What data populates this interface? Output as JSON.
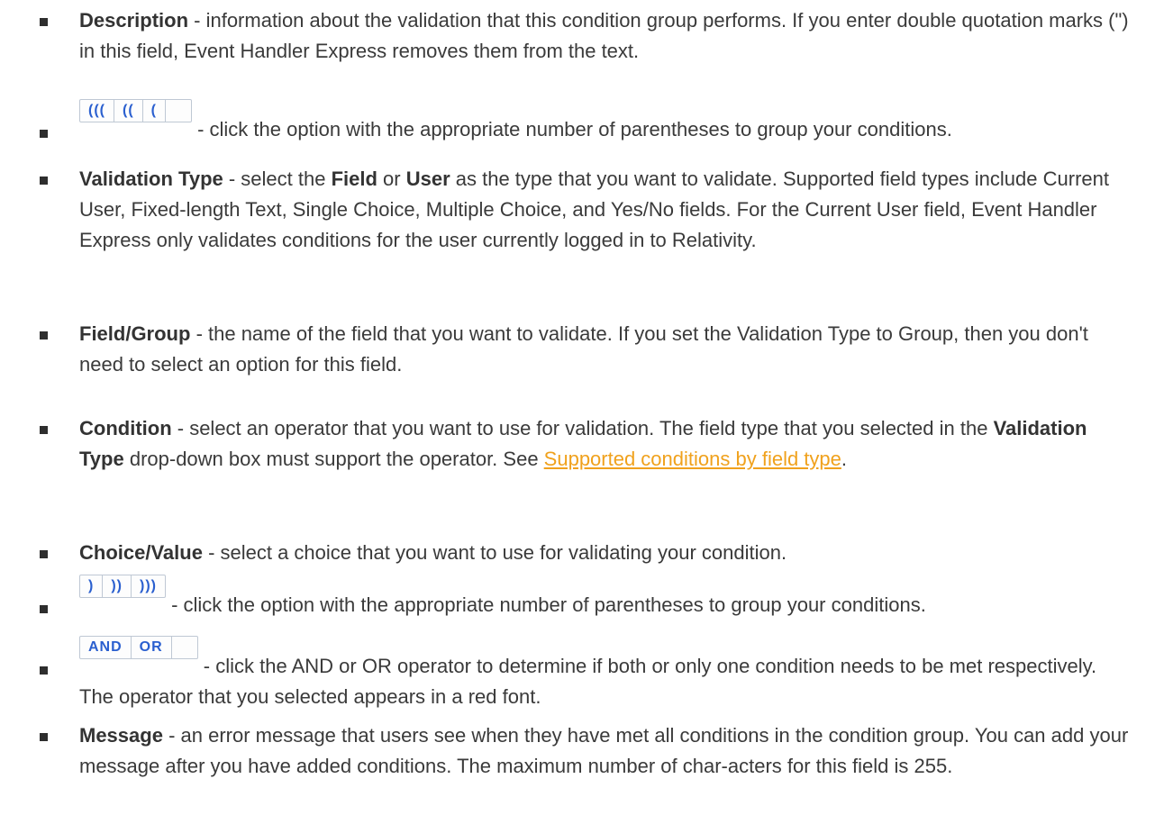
{
  "items": [
    {
      "term": "Description",
      "text": " - information about the validation that this condition group performs. If you enter double quotation marks (\") in this field, Event Handler Express removes them from the text."
    },
    {
      "buttons": [
        "(((",
        "((",
        "("
      ],
      "text": "- click the option with the appropriate number of parentheses to group your conditions."
    },
    {
      "term": "Validation Type",
      "text_a": " - select the ",
      "term_b": "Field",
      "text_b": " or ",
      "term_c": "User",
      "text_c": " as the type that you want to validate. Supported field types include Current User, Fixed-length Text, Single Choice, Multiple Choice, and Yes/No fields. For the Current User field, Event Handler Express only validates conditions for the user currently logged in to Relativity."
    },
    {
      "term": "Field/Group",
      "text": " - the name of the field that you want to validate. If you set the Validation Type to Group, then you don't need to select an option for this field."
    },
    {
      "term": "Condition",
      "text_a": " - select an operator that you want to use for validation. The field type that you selected in the ",
      "term_b": "Validation Type",
      "text_b": " drop-down box must support the operator. See ",
      "link": "Supported conditions by field type",
      "text_c": "."
    },
    {
      "term": "Choice/Value",
      "text": " - select a choice that you want to use for validating your condition."
    },
    {
      "buttons": [
        ")",
        "))",
        ")))"
      ],
      "text": "- click the option with the appropriate number of parentheses to group your conditions."
    },
    {
      "buttons": [
        "AND",
        "OR"
      ],
      "text": "- click the AND or OR operator to determine if both or only one condition needs to be met respectively. The operator that you selected appears in a red font."
    },
    {
      "term": "Message",
      "text": " - an error message that users see when they have met all conditions in the condition group. You can add your message after you have added conditions. The maximum number of char-acters for this field is 255."
    }
  ]
}
